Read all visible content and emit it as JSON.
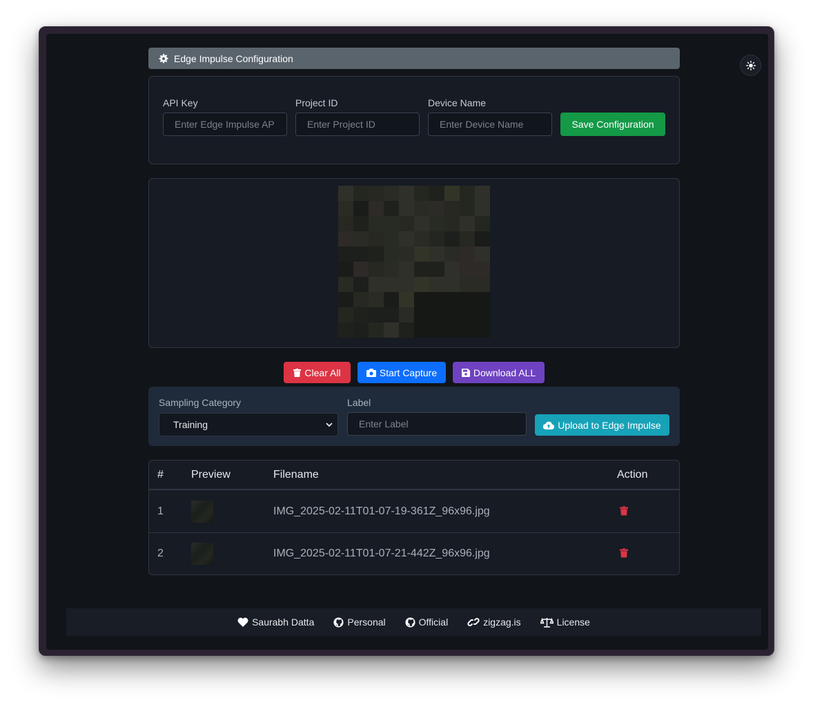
{
  "config": {
    "header_title": "Edge Impulse Configuration",
    "api_key_label": "API Key",
    "api_key_placeholder": "Enter Edge Impulse API",
    "project_id_label": "Project ID",
    "project_id_placeholder": "Enter Project ID",
    "device_name_label": "Device Name",
    "device_name_placeholder": "Enter Device Name",
    "save_label": "Save Configuration"
  },
  "actions": {
    "clear_label": "Clear All",
    "capture_label": "Start Capture",
    "download_label": "Download ALL"
  },
  "sampling": {
    "category_label": "Sampling Category",
    "category_value": "Training",
    "label_label": "Label",
    "label_placeholder": "Enter Label",
    "upload_label": "Upload to Edge Impulse"
  },
  "table": {
    "headers": [
      "#",
      "Preview",
      "Filename",
      "Action"
    ],
    "rows": [
      {
        "index": "1",
        "filename": "IMG_2025-02-11T01-07-19-361Z_96x96.jpg"
      },
      {
        "index": "2",
        "filename": "IMG_2025-02-11T01-07-21-442Z_96x96.jpg"
      }
    ]
  },
  "footer": {
    "links": [
      "Saurabh Datta",
      "Personal",
      "Official",
      "zigzag.is",
      "License"
    ]
  },
  "icons": {
    "settings": "gear-icon",
    "theme": "sun-icon",
    "clear": "trash-icon",
    "capture": "camera-icon",
    "download": "save-icon",
    "upload": "cloud-upload-icon",
    "author": "heart-icon",
    "personal": "github-icon",
    "official": "github-icon",
    "website": "link-icon",
    "license": "balance-scale-icon"
  },
  "colors": {
    "save": "#149947",
    "clear": "#dc3444",
    "capture": "#0d6efd",
    "download": "#6f42c1",
    "upload": "#17a2b8",
    "delete": "#dc3444"
  }
}
